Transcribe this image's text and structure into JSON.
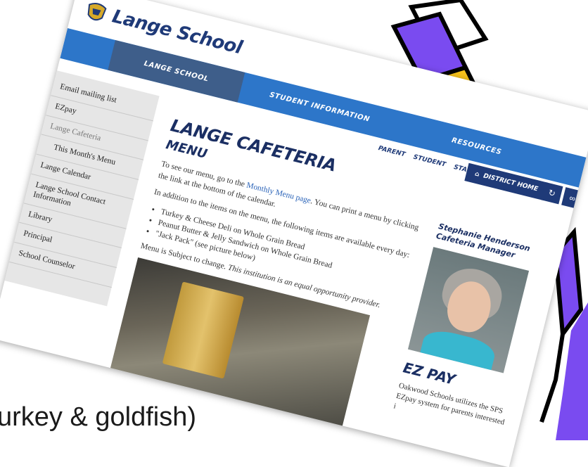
{
  "caption": "urkey & goldfish)",
  "site": {
    "logo_text": "Lange School",
    "nav_tabs": [
      {
        "label": "LANGE SCHOOL"
      },
      {
        "label": "STUDENT INFORMATION"
      },
      {
        "label": "RESOURCES"
      }
    ],
    "util_links": [
      "PARENT",
      "STUDENT",
      "STAFF"
    ],
    "district_home": "DISTRICT HOME",
    "sidebar": [
      "Email mailing list",
      "EZpay",
      "Lange Cafeteria",
      "This Month's Menu",
      "Lange Calendar",
      "Lange School Contact Information",
      "Library",
      "Principal",
      "School Counselor"
    ],
    "page_title": "LANGE CAFETERIA",
    "page_subtitle": "MENU",
    "intro_before_link": "To see our menu, go to the ",
    "intro_link": "Monthly Menu page",
    "intro_after_link": ". You can print a menu by clicking the link at the bottom of the calendar.",
    "addition_text": "In addition to the items on the menu, the following items are available every day:",
    "items": [
      "Turkey & Cheese Deli on Whole Grain Bread",
      "Peanut Butter & Jelly Sandwich on Whole Grain Bread",
      "\"Jack Pack\" (see picture below)"
    ],
    "subject_change": "Menu is Subject to change. ",
    "equal_opportunity": "This institution is an equal opportunity provider.",
    "staff_name": "Stephanie Henderson",
    "staff_title": "Cafeteria Manager",
    "ez_title": "EZ PAY",
    "ez_text": "Oakwood Schools utilizes the SPS EZpay system for parents interested i"
  },
  "colors": {
    "nav_blue": "#2d76c9",
    "nav_active": "#3e5e8a",
    "navy": "#1b2f63",
    "pencil_yellow": "#f7c21c",
    "pencil_purple": "#7a4bf0"
  }
}
